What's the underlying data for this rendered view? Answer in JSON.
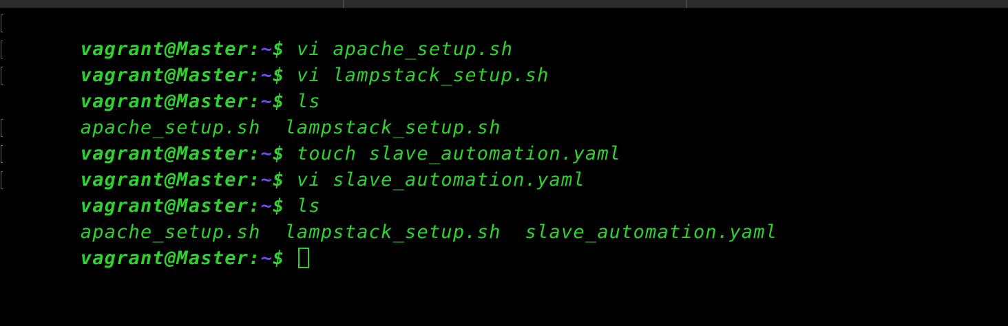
{
  "prompt": {
    "user_host": "vagrant@Master:",
    "path": "~",
    "symbol": "$"
  },
  "lines": [
    {
      "type": "prompt",
      "command": " vi apache_setup.sh"
    },
    {
      "type": "prompt",
      "command": " vi lampstack_setup.sh"
    },
    {
      "type": "prompt",
      "command": " ls"
    },
    {
      "type": "output",
      "text": "apache_setup.sh  lampstack_setup.sh"
    },
    {
      "type": "prompt",
      "command": " touch slave_automation.yaml"
    },
    {
      "type": "prompt",
      "command": " vi slave_automation.yaml"
    },
    {
      "type": "prompt",
      "command": " ls"
    },
    {
      "type": "output",
      "text": "apache_setup.sh  lampstack_setup.sh  slave_automation.yaml"
    },
    {
      "type": "prompt",
      "command": " "
    }
  ],
  "colors": {
    "background": "#000000",
    "text": "#2fd12f",
    "path": "#6a4cf0"
  }
}
